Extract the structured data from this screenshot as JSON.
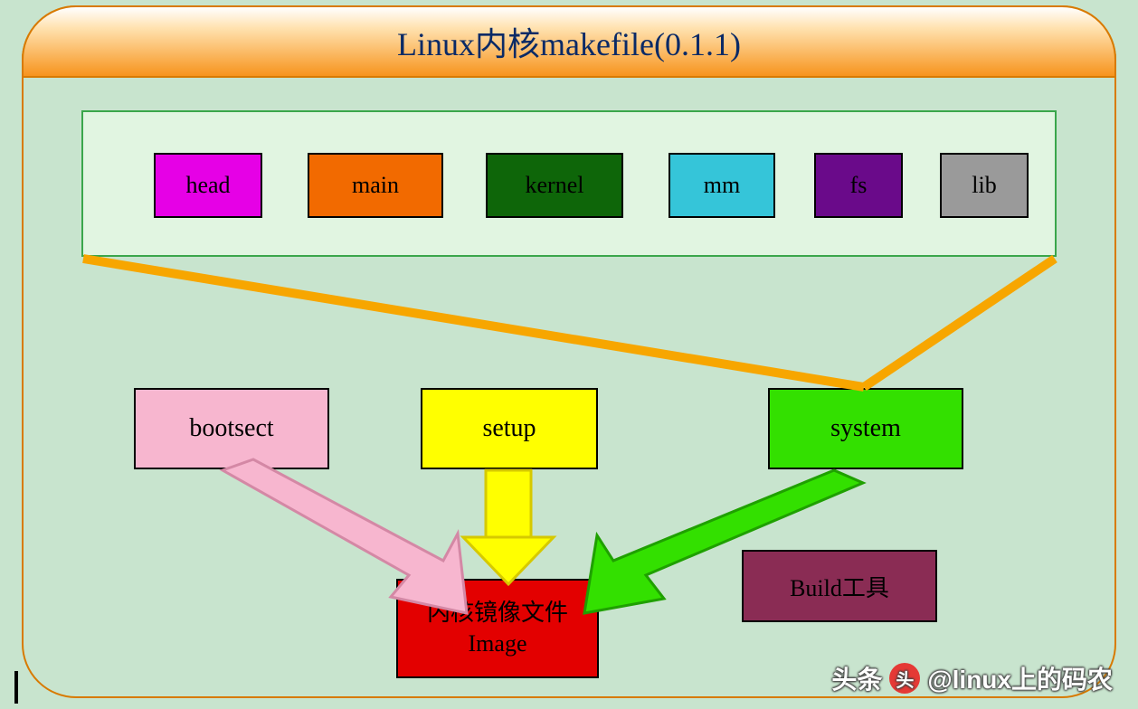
{
  "title": "Linux内核makefile(0.1.1)",
  "components": {
    "head": "head",
    "main": "main",
    "kernel": "kernel",
    "mm": "mm",
    "fs": "fs",
    "lib": "lib"
  },
  "stages": {
    "bootsect": "bootsect",
    "setup": "setup",
    "system": "system"
  },
  "build_tool": "Build工具",
  "image_box": {
    "line1": "内核镜像文件",
    "line2": "Image"
  },
  "watermark": {
    "prefix": "头条",
    "handle": "@linux上的码农"
  },
  "colors": {
    "frame_border": "#d87a00",
    "bg": "#c8e4ce",
    "arrow_orange": "#f7a600",
    "arrow_pink": "#f7b6cf",
    "arrow_yellow": "#ffff00",
    "arrow_green": "#33e000"
  }
}
